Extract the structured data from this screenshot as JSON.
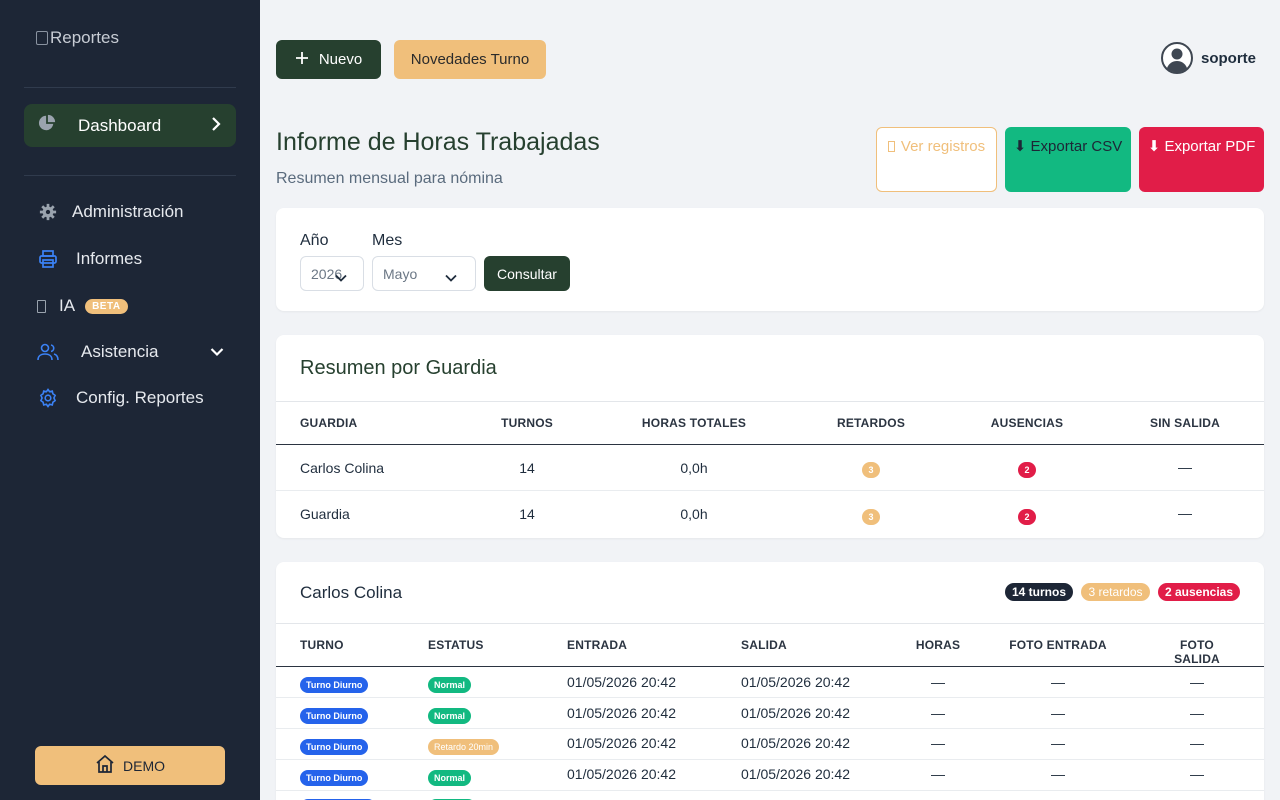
{
  "sidebar": {
    "logo_alt": "Reportes",
    "dashboard": "Dashboard",
    "items": [
      {
        "label": "Administración",
        "icon": "gear-icon"
      },
      {
        "label": "Informes",
        "icon": "printer-icon"
      },
      {
        "label": "IA",
        "icon": "broken-image-icon",
        "badge": "BETA"
      },
      {
        "label": "Asistencia",
        "icon": "users-icon"
      },
      {
        "label": "Config. Reportes",
        "icon": "settings-icon"
      }
    ],
    "demo": "DEMO"
  },
  "topbar": {
    "new_label": "Nuevo",
    "news_label": "Novedades Turno",
    "username": "soporte"
  },
  "header": {
    "title": "Informe de Horas Trabajadas",
    "subtitle": "Resumen mensual para nómina",
    "ver_registros": "Ver registros",
    "export_csv": "⬇ Exportar CSV",
    "export_pdf": "⬇ Exportar PDF"
  },
  "filters": {
    "year_label": "Año",
    "year_value": "2026",
    "month_label": "Mes",
    "month_value": "Mayo",
    "submit": "Consultar"
  },
  "summary": {
    "title": "Resumen por Guardia",
    "columns": [
      "GUARDIA",
      "TURNOS",
      "HORAS TOTALES",
      "RETARDOS",
      "AUSENCIAS",
      "SIN SALIDA"
    ],
    "rows": [
      {
        "guardia": "Carlos Colina",
        "turnos": "14",
        "horas": "0,0h",
        "retardos": "3",
        "ausencias": "2",
        "sin_salida": "—"
      },
      {
        "guardia": "Guardia",
        "turnos": "14",
        "horas": "0,0h",
        "retardos": "3",
        "ausencias": "2",
        "sin_salida": "—"
      }
    ]
  },
  "detail": {
    "title": "Carlos Colina",
    "badges": {
      "turnos": "14 turnos",
      "retardos": "3 retardos",
      "ausencias": "2 ausencias"
    },
    "columns": [
      "TURNO",
      "ESTATUS",
      "ENTRADA",
      "SALIDA",
      "HORAS",
      "FOTO ENTRADA",
      "FOTO SALIDA"
    ],
    "rows": [
      {
        "turno": "Turno Diurno",
        "estatus": "Normal",
        "entrada": "01/05/2026 20:42",
        "salida": "01/05/2026 20:42",
        "horas": "—",
        "foto_entrada": "—",
        "foto_salida": "—"
      },
      {
        "turno": "Turno Diurno",
        "estatus": "Normal",
        "entrada": "01/05/2026 20:42",
        "salida": "01/05/2026 20:42",
        "horas": "—",
        "foto_entrada": "—",
        "foto_salida": "—"
      },
      {
        "turno": "Turno Diurno",
        "estatus": "Retardo 20min",
        "entrada": "01/05/2026 20:42",
        "salida": "01/05/2026 20:42",
        "horas": "—",
        "foto_entrada": "—",
        "foto_salida": "—"
      },
      {
        "turno": "Turno Diurno",
        "estatus": "Normal",
        "entrada": "01/05/2026 20:42",
        "salida": "01/05/2026 20:42",
        "horas": "—",
        "foto_entrada": "—",
        "foto_salida": "—"
      }
    ]
  },
  "colors": {
    "sidebar_bg": "#1d2636",
    "primary_green": "#26402f",
    "accent_orange": "#f0bf7b",
    "success": "#12b981",
    "danger": "#e11d48",
    "info_blue": "#2563eb"
  }
}
